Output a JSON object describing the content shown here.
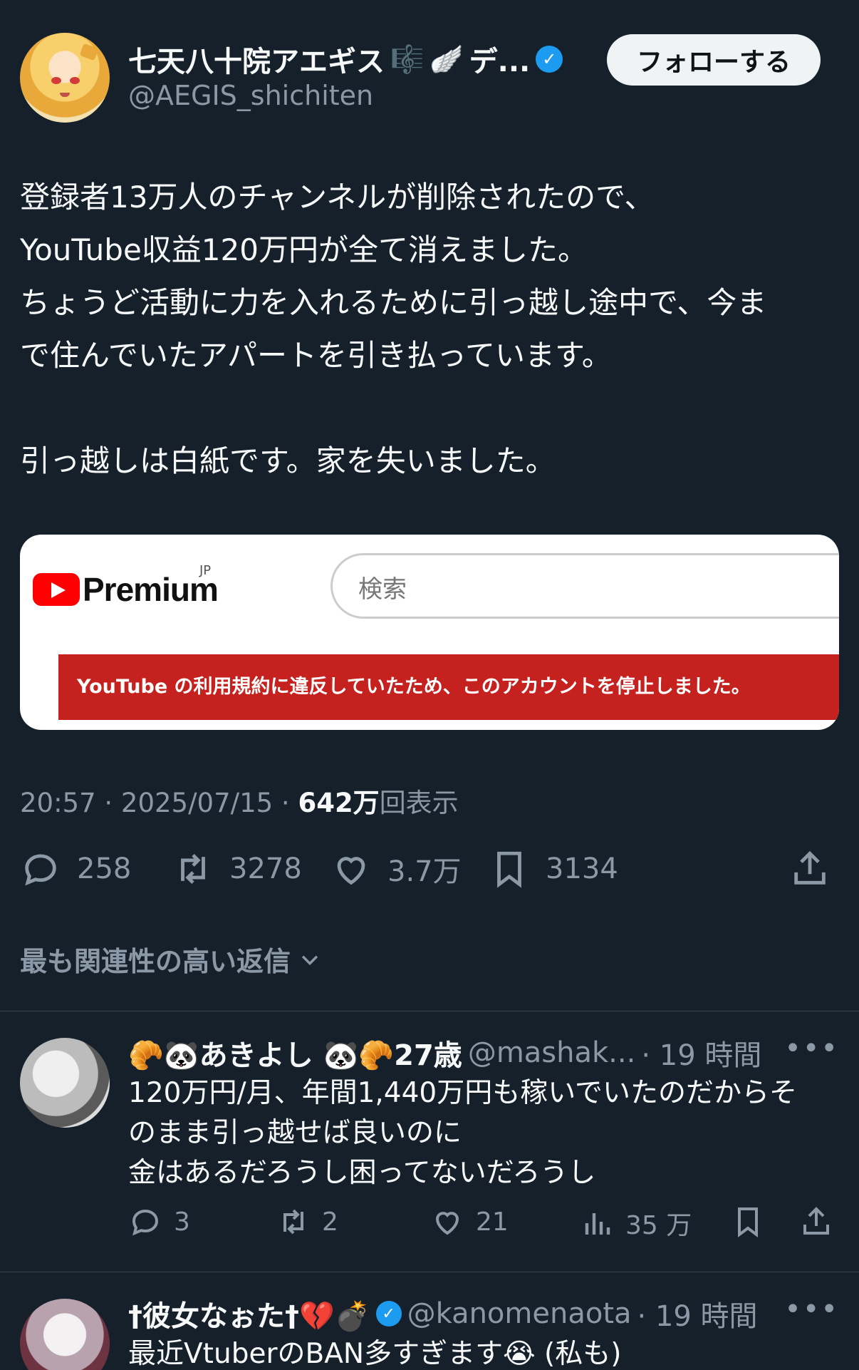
{
  "tweet": {
    "display_name": "七天八十院アエギス",
    "name_emojis": [
      "🎼",
      "🪽"
    ],
    "name_suffix": "デ...",
    "handle": "@AEGIS_shichiten",
    "follow_label": "フォローする",
    "lines": [
      "登録者13万人のチャンネルが削除されたので、",
      "YouTube収益120万円が全て消えました。",
      "ちょうど活動に力を入れるために引っ越し途中で、今ま",
      "で住んでいたアパートを引き払っています。",
      "引っ越しは白紙です。家を失いました。"
    ],
    "meta_time": "20:57 · 2025/07/15 · ",
    "meta_views_value": "642万",
    "meta_views_label": "回表示",
    "replies_count": "258",
    "reposts_count": "3278",
    "likes_count": "3.7万",
    "bookmarks_count": "3134"
  },
  "embed": {
    "logo_text": "Premium",
    "region": "JP",
    "search_placeholder": "検索",
    "banner_text": "YouTube の利用規約に違反していたため、このアカウントを停止しました。"
  },
  "sort": {
    "label": "最も関連性の高い返信"
  },
  "replies": [
    {
      "name": "🥐🐼あきよし 🐼🥐27歳",
      "handle": "@mashak...",
      "time": "· 19 時間",
      "more": "•••",
      "lines": [
        "120万円/月、年間1,440万円も稼いでいたのだからそ",
        "のまま引っ越せば良いのに",
        "金はあるだろうし困ってないだろうし"
      ],
      "reply_count": "3",
      "repost_count": "2",
      "like_count": "21",
      "view_count": "35 万"
    },
    {
      "name": "†彼女なぉた†💔💣",
      "handle": "@kanomenaota",
      "time": "· 19 時間",
      "more": "•••",
      "lines": [
        "最近VtuberのBAN多すぎます😭 (私も)"
      ]
    }
  ],
  "colors": {
    "background": "#15202b",
    "verified": "#1d9bf0",
    "muted": "#8b98a5",
    "banner": "#c5221f"
  }
}
